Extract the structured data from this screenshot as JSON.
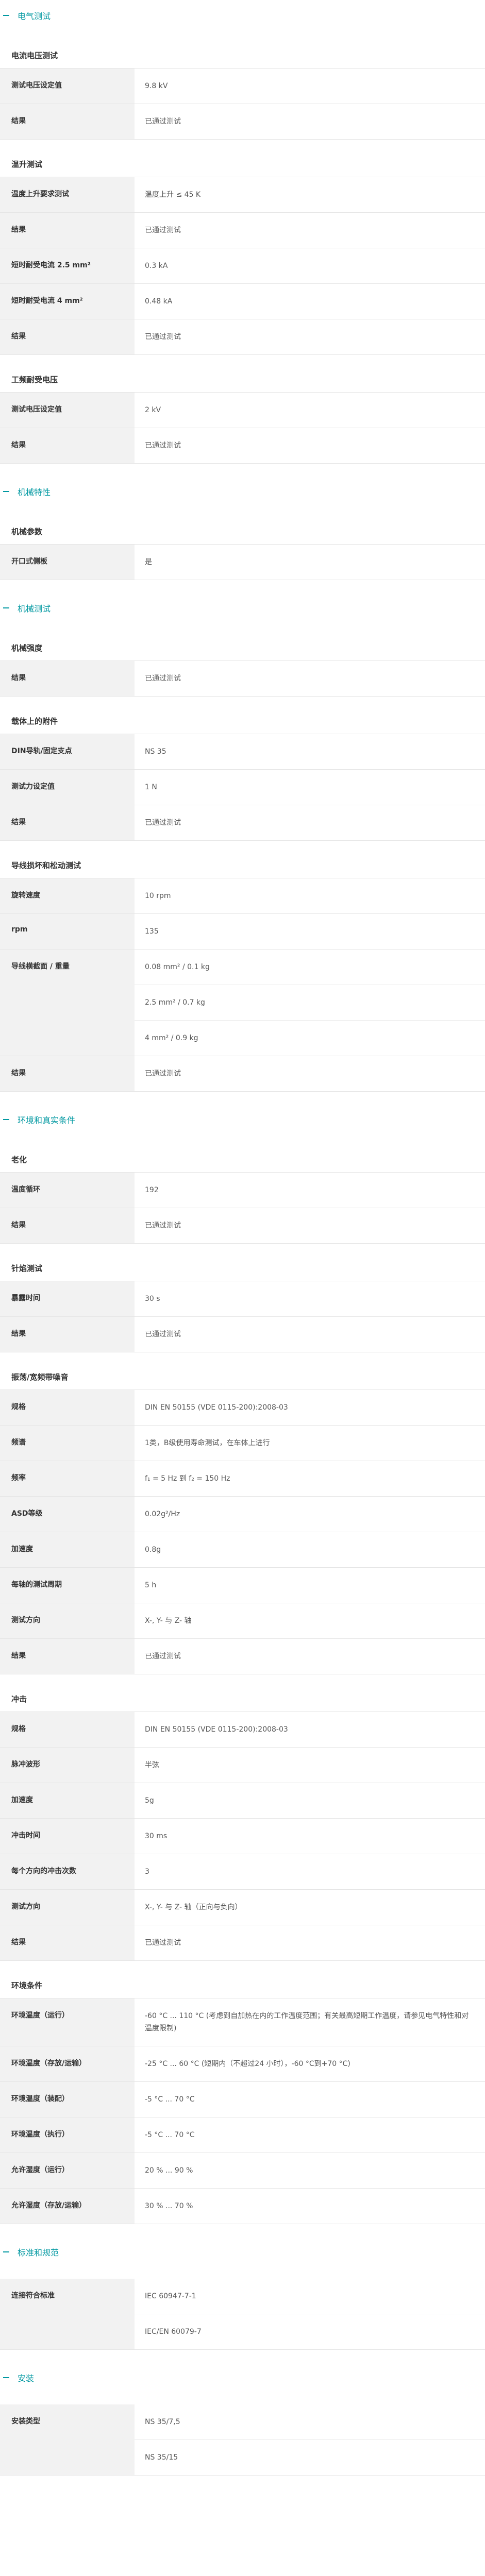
{
  "sections": [
    {
      "title": "电气测试",
      "groups": [
        {
          "title": "电流电压测试",
          "rows": [
            {
              "label": "测试电压设定值",
              "values": [
                "9.8 kV"
              ]
            },
            {
              "label": "结果",
              "values": [
                "已通过测试"
              ]
            }
          ]
        },
        {
          "title": "温升测试",
          "rows": [
            {
              "label": "温度上升要求测试",
              "values": [
                "温度上升 ≤ 45 K"
              ]
            },
            {
              "label": "结果",
              "values": [
                "已通过测试"
              ]
            },
            {
              "label": "短时耐受电流 2.5 mm²",
              "values": [
                "0.3 kA"
              ]
            },
            {
              "label": "短时耐受电流 4 mm²",
              "values": [
                "0.48 kA"
              ]
            },
            {
              "label": "结果",
              "values": [
                "已通过测试"
              ]
            }
          ]
        },
        {
          "title": "工频耐受电压",
          "rows": [
            {
              "label": "测试电压设定值",
              "values": [
                "2 kV"
              ]
            },
            {
              "label": "结果",
              "values": [
                "已通过测试"
              ]
            }
          ]
        }
      ]
    },
    {
      "title": "机械特性",
      "groups": [
        {
          "title": "机械参数",
          "rows": [
            {
              "label": "开口式侧板",
              "values": [
                "是"
              ]
            }
          ]
        }
      ]
    },
    {
      "title": "机械测试",
      "groups": [
        {
          "title": "机械强度",
          "rows": [
            {
              "label": "结果",
              "values": [
                "已通过测试"
              ]
            }
          ]
        },
        {
          "title": "载体上的附件",
          "rows": [
            {
              "label": "DIN导轨/固定支点",
              "values": [
                "NS 35"
              ]
            },
            {
              "label": "测试力设定值",
              "values": [
                "1 N"
              ]
            },
            {
              "label": "结果",
              "values": [
                "已通过测试"
              ]
            }
          ]
        },
        {
          "title": "导线损坏和松动测试",
          "rows": [
            {
              "label": "旋转速度",
              "values": [
                "10 rpm"
              ]
            },
            {
              "label": "rpm",
              "values": [
                "135"
              ]
            },
            {
              "label": "导线横截面 / 重量",
              "values": [
                "0.08 mm² / 0.1 kg",
                "2.5 mm² / 0.7 kg",
                "4 mm² / 0.9 kg"
              ]
            },
            {
              "label": "结果",
              "values": [
                "已通过测试"
              ]
            }
          ]
        }
      ]
    },
    {
      "title": "环境和真实条件",
      "groups": [
        {
          "title": "老化",
          "rows": [
            {
              "label": "温度循环",
              "values": [
                "192"
              ]
            },
            {
              "label": "结果",
              "values": [
                "已通过测试"
              ]
            }
          ]
        },
        {
          "title": "针焰测试",
          "rows": [
            {
              "label": "暴露时间",
              "values": [
                "30 s"
              ]
            },
            {
              "label": "结果",
              "values": [
                "已通过测试"
              ]
            }
          ]
        },
        {
          "title": "振荡/宽频带噪音",
          "rows": [
            {
              "label": "规格",
              "values": [
                "DIN EN 50155 (VDE 0115-200):2008-03"
              ]
            },
            {
              "label": "频谱",
              "values": [
                "1类，B级使用寿命测试，在车体上进行"
              ]
            },
            {
              "label": "频率",
              "values": [
                "f₁ = 5 Hz 到 f₂ = 150 Hz"
              ]
            },
            {
              "label": "ASD等级",
              "values": [
                "0.02g²/Hz"
              ]
            },
            {
              "label": "加速度",
              "values": [
                "0.8g"
              ]
            },
            {
              "label": "每轴的测试周期",
              "values": [
                "5 h"
              ]
            },
            {
              "label": "测试方向",
              "values": [
                "X-, Y- 与 Z- 轴"
              ]
            },
            {
              "label": "结果",
              "values": [
                "已通过测试"
              ]
            }
          ]
        },
        {
          "title": "冲击",
          "rows": [
            {
              "label": "规格",
              "values": [
                "DIN EN 50155 (VDE 0115-200):2008-03"
              ]
            },
            {
              "label": "脉冲波形",
              "values": [
                "半弦"
              ]
            },
            {
              "label": "加速度",
              "values": [
                "5g"
              ]
            },
            {
              "label": "冲击时间",
              "values": [
                "30 ms"
              ]
            },
            {
              "label": "每个方向的冲击次数",
              "values": [
                "3"
              ]
            },
            {
              "label": "测试方向",
              "values": [
                "X-, Y- 与 Z- 轴（正向与负向）"
              ]
            },
            {
              "label": "结果",
              "values": [
                "已通过测试"
              ]
            }
          ]
        },
        {
          "title": "环境条件",
          "rows": [
            {
              "label": "环境温度（运行）",
              "values": [
                "-60 °C ... 110 °C (考虑到自加热在内的工作温度范围；有关最高短期工作温度，请参见电气特性和对温度限制)"
              ]
            },
            {
              "label": "环境温度（存放/运输）",
              "values": [
                "-25 °C ... 60 °C (短期内（不超过24 小时），-60 °C到+70 °C)"
              ]
            },
            {
              "label": "环境温度（装配）",
              "values": [
                "-5 °C ... 70 °C"
              ]
            },
            {
              "label": "环境温度（执行）",
              "values": [
                "-5 °C ... 70 °C"
              ]
            },
            {
              "label": "允许湿度（运行）",
              "values": [
                "20 % ... 90 %"
              ]
            },
            {
              "label": "允许湿度（存放/运输）",
              "values": [
                "30 % ... 70 %"
              ]
            }
          ]
        }
      ]
    },
    {
      "title": "标准和规范",
      "groups": [
        {
          "title": "",
          "rows": [
            {
              "label": "连接符合标准",
              "values": [
                "IEC 60947-7-1",
                "IEC/EN 60079-7"
              ]
            }
          ]
        }
      ]
    },
    {
      "title": "安装",
      "groups": [
        {
          "title": "",
          "rows": [
            {
              "label": "安装类型",
              "values": [
                "NS 35/7,5",
                "NS 35/15"
              ]
            }
          ]
        }
      ]
    }
  ]
}
